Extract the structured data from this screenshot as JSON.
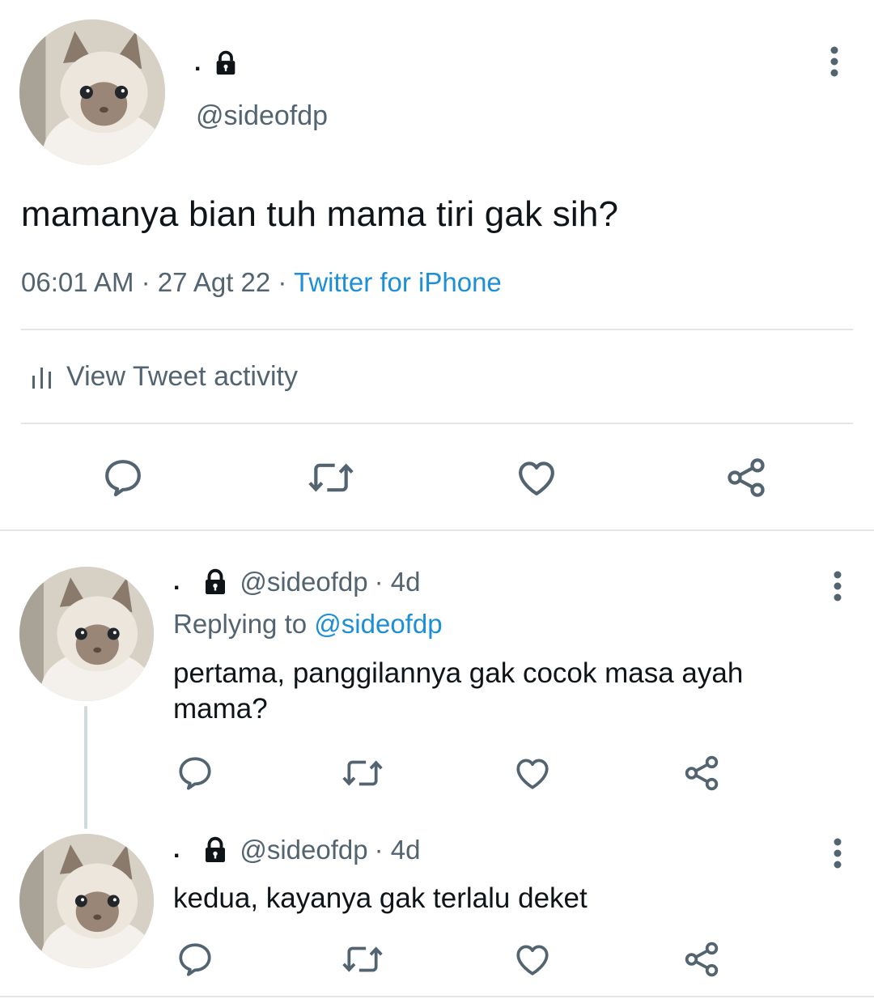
{
  "tweet": {
    "display_name": ".",
    "handle": "@sideofdp",
    "text": "mamanya bian tuh mama tiri gak sih?",
    "time": "06:01 AM",
    "date": "27 Agt 22",
    "sep": "·",
    "source": "Twitter for iPhone",
    "activity_label": "View Tweet activity"
  },
  "replies": [
    {
      "display_name": ".",
      "handle": "@sideofdp",
      "age": "· 4d",
      "replying_label": "Replying to",
      "replying_to": "@sideofdp",
      "text": "pertama, panggilannya gak cocok masa ayah mama?"
    },
    {
      "display_name": ".",
      "handle": "@sideofdp",
      "age": "· 4d",
      "text": "kedua, kayanya gak terlalu deket"
    }
  ],
  "icons": {
    "avatar": "cat-avatar",
    "lock": "lock-icon",
    "more": "more-vertical-icon",
    "activity": "bar-chart-icon",
    "reply": "comment-icon",
    "retweet": "retweet-icon",
    "like": "heart-icon",
    "share": "share-icon"
  },
  "colors": {
    "link": "#1d8fd6",
    "secondary_text": "#536471",
    "icon": "#536471",
    "divider": "#e3e6e8",
    "thread_line": "#cfd9de"
  }
}
